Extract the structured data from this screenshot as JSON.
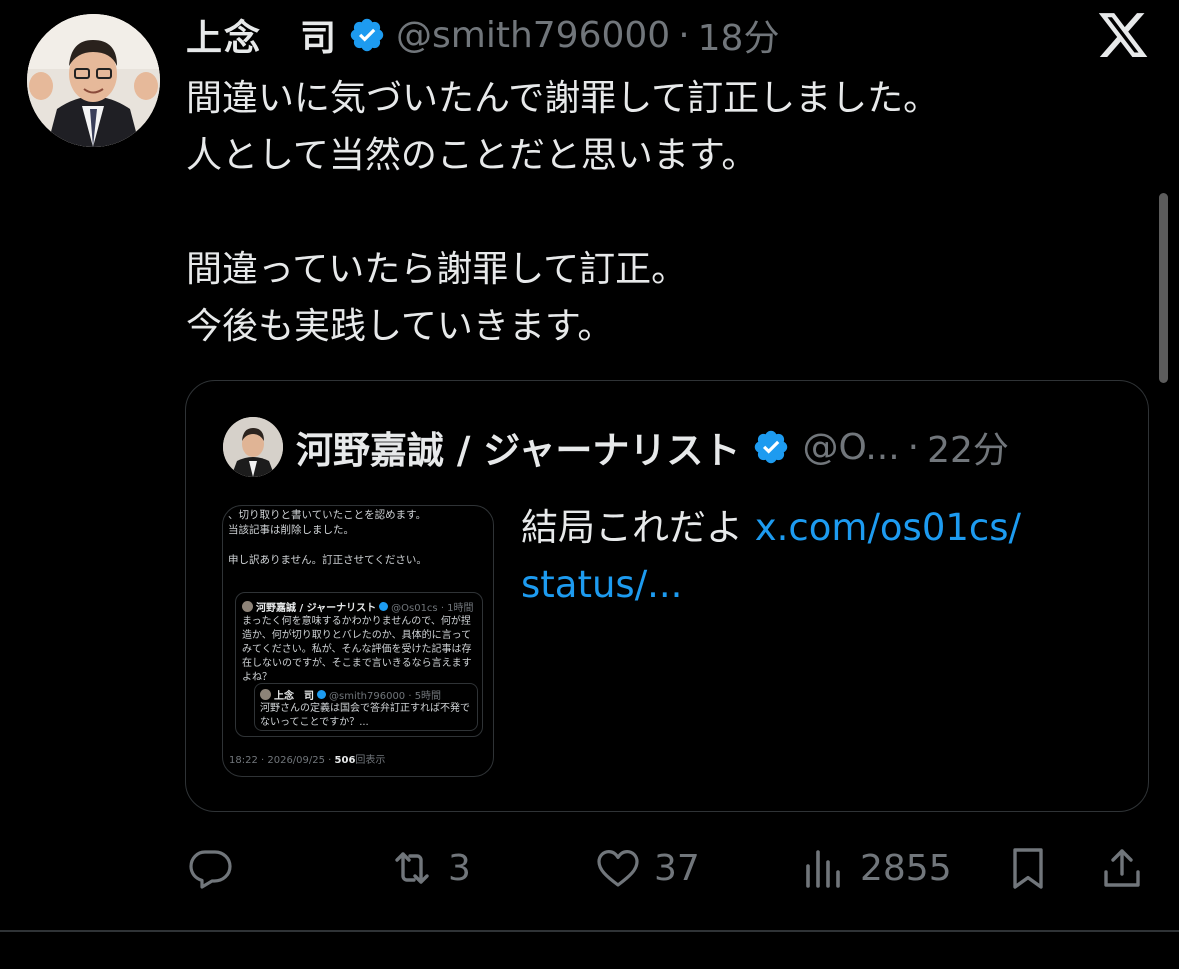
{
  "tweet": {
    "author_name": "上念　司",
    "author_handle": "@smith796000",
    "separator": "·",
    "time": "18分",
    "body": "間違いに気づいたんで謝罪して訂正しました。\n人として当然のことだと思います。\n\n間違っていたら謝罪して訂正。\n今後も実践していきます。"
  },
  "quote": {
    "author_name": "河野嘉誠 / ジャーナリスト",
    "author_handle": "@O...",
    "separator": "·",
    "time": "22分",
    "text": "結局これだよ ",
    "link_text": "x.com/os01cs/\nstatus/..."
  },
  "thumbnail": {
    "lines": [
      "、切り取りと書いていたことを認めます。",
      "当該記事は削除しました。",
      "",
      "申し訳ありません。訂正させてください。"
    ],
    "inner_name": "河野嘉誠 / ジャーナリスト",
    "inner_handle": "@Os01cs · 1時間",
    "inner_body": "まったく何を意味するかわかりませんので、何が捏造か、何が切り取りとバレたのか、具体的に言ってみてください。私が、そんな評価を受けた記事は存在しないのですが、そこまで言いきるなら言えますよね？",
    "deep_name": "上念　司",
    "deep_handle": "@smith796000 · 5時間",
    "deep_body": "河野さんの定義は国会で答弁訂正すれば不発でないってことですか？...",
    "footer_time": "18:22 · 2026/09/25 · ",
    "footer_views": "506",
    "footer_views_label": "回表示"
  },
  "actions": {
    "reply_icon": "reply-icon",
    "retweet_count": "3",
    "like_count": "37",
    "views_count": "2855",
    "bookmark_icon": "bookmark-icon",
    "share_icon": "share-icon"
  },
  "colors": {
    "background": "#000000",
    "text": "#e7e9ea",
    "muted": "#71767b",
    "accent": "#1d9bf0",
    "border": "#2f3336"
  }
}
